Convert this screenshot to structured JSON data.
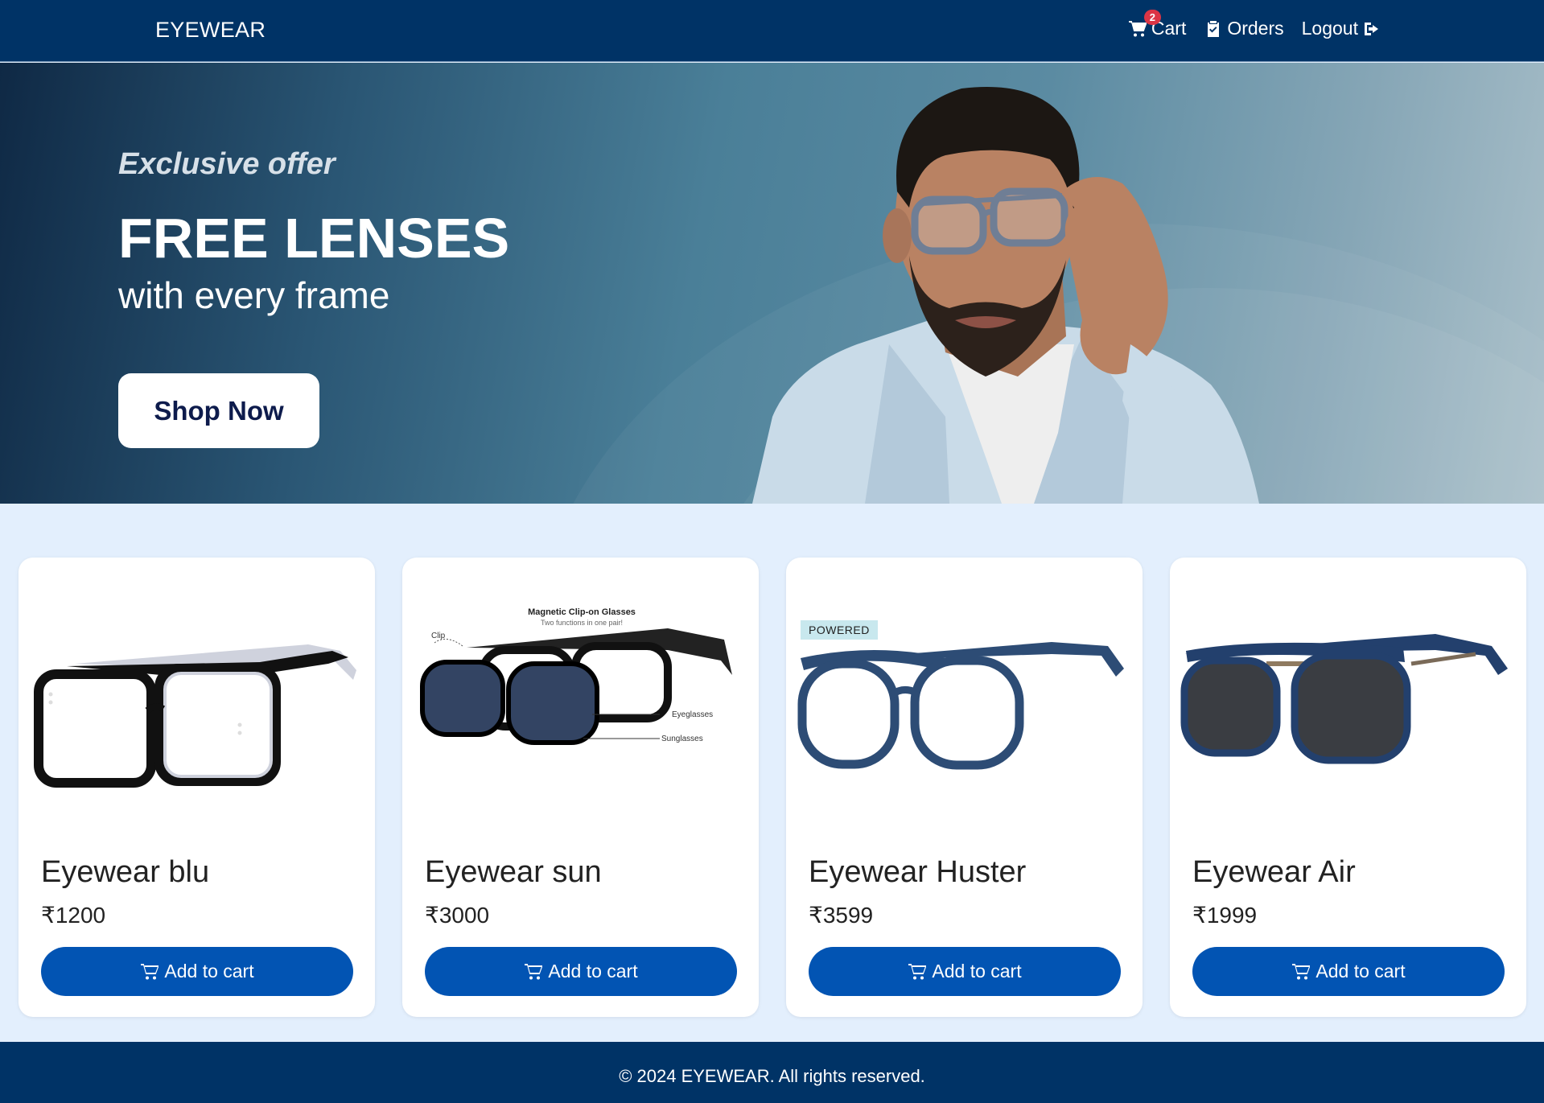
{
  "navbar": {
    "brand": "EYEWEAR",
    "cart_label": "Cart",
    "cart_count": "2",
    "orders_label": "Orders",
    "logout_label": "Logout"
  },
  "hero": {
    "offer": "Exclusive offer",
    "title": "FREE LENSES",
    "subtitle": "with every frame",
    "button": "Shop Now"
  },
  "products": [
    {
      "name": "Eyewear blu",
      "price": "₹1200",
      "button": "Add to cart"
    },
    {
      "name": "Eyewear sun",
      "price": "₹3000",
      "button": "Add to cart",
      "image_text": {
        "heading": "Magnetic Clip-on Glasses",
        "subheading": "Two functions in one pair!",
        "clip": "Clip",
        "eyeglasses": "Eyeglasses",
        "sunglasses": "Sunglasses"
      }
    },
    {
      "name": "Eyewear Huster",
      "price": "₹3599",
      "button": "Add to cart",
      "tag": "POWERED"
    },
    {
      "name": "Eyewear Air",
      "price": "₹1999",
      "button": "Add to cart"
    }
  ],
  "footer": {
    "text": "© 2024 EYEWEAR. All rights reserved."
  },
  "colors": {
    "navy": "#003366",
    "accent_button": "#0254b3",
    "page_bg": "#e3effd",
    "badge": "#dc3545"
  }
}
